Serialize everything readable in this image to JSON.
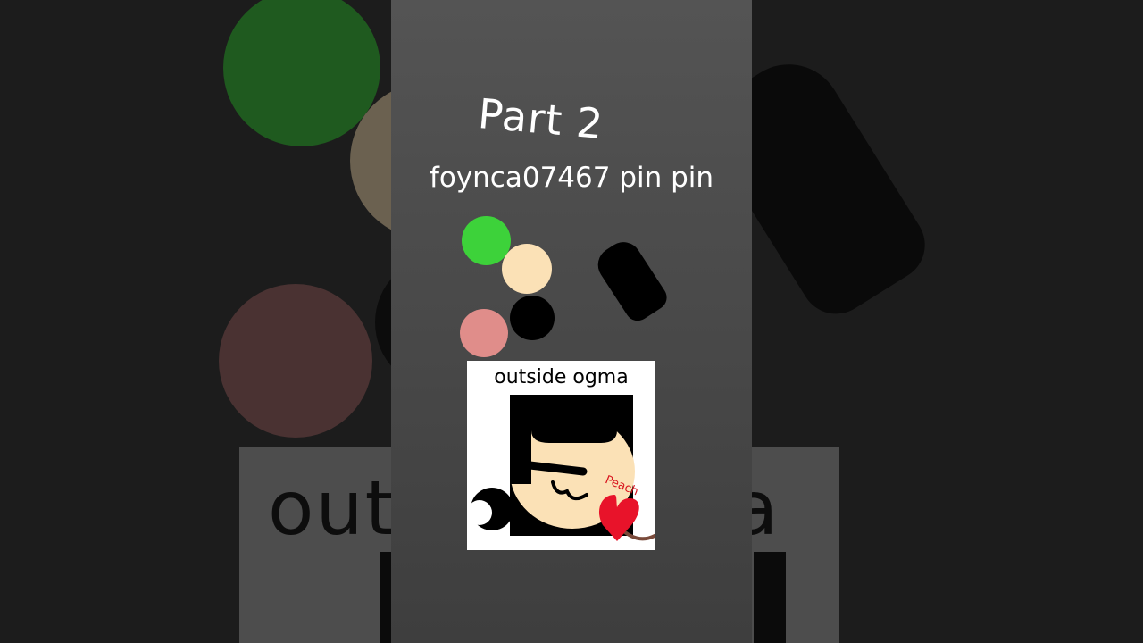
{
  "title": "Part 2",
  "subtitle": "foynca07467 pin pin",
  "card": {
    "label": "outside ogma",
    "tag": "Peach"
  },
  "background_echo": {
    "left_text": "out",
    "right_text": "a"
  },
  "colors": {
    "panel": "#4d4d4d",
    "green": "#3dd23a",
    "peach": "#fbe1b6",
    "pink": "#e08d8a",
    "black": "#000000",
    "heart_red": "#e8132a"
  }
}
